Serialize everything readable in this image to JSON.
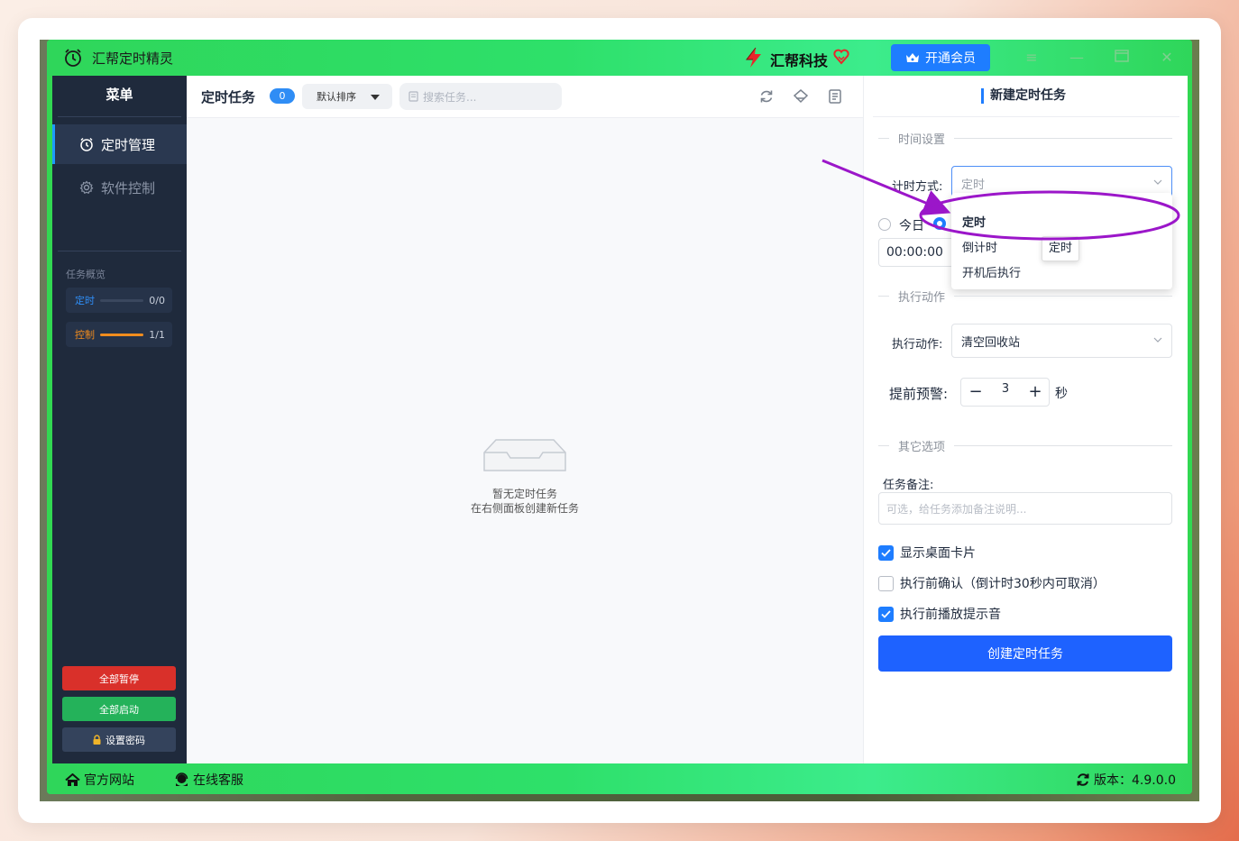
{
  "app": {
    "title": "汇帮定时精灵",
    "brand": "汇帮科技",
    "vip_button": "开通会员"
  },
  "sidebar": {
    "title": "菜单",
    "items": [
      {
        "label": "定时管理",
        "icon": "alarm-clock-icon",
        "active": true
      },
      {
        "label": "软件控制",
        "icon": "gear-icon",
        "active": false
      }
    ],
    "overview_label": "任务概览",
    "overview": [
      {
        "label": "定时",
        "count": "0/0",
        "progress": 0,
        "color": "#2f8df5"
      },
      {
        "label": "控制",
        "count": "1/1",
        "progress": 1,
        "color": "#f08c1e"
      }
    ],
    "buttons": {
      "pause_all": "全部暂停",
      "start_all": "全部启动",
      "set_password": "设置密码"
    }
  },
  "main": {
    "title": "定时任务",
    "count": "0",
    "sort_label": "默认排序",
    "search_placeholder": "搜索任务...",
    "empty_line1": "暂无定时任务",
    "empty_line2": "在右侧面板创建新任务"
  },
  "form": {
    "title": "新建定时任务",
    "section_time": "时间设置",
    "timing_mode_label": "计时方式:",
    "timing_mode_value": "定时",
    "dropdown_options": [
      "定时",
      "倒计时",
      "开机后执行"
    ],
    "tooltip": "定时",
    "radio_today": "今日",
    "time_value": "00:00:00",
    "section_action": "执行动作",
    "action_label": "执行动作:",
    "action_value": "清空回收站",
    "warn_label": "提前预警:",
    "warn_value": "3",
    "warn_unit": "秒",
    "section_other": "其它选项",
    "note_label": "任务备注:",
    "note_placeholder": "可选，给任务添加备注说明...",
    "checks": [
      {
        "label": "显示桌面卡片",
        "checked": true
      },
      {
        "label": "执行前确认（倒计时30秒内可取消）",
        "checked": false
      },
      {
        "label": "执行前播放提示音",
        "checked": true
      }
    ],
    "create_button": "创建定时任务"
  },
  "footer": {
    "website": "官方网站",
    "support": "在线客服",
    "version": "版本：4.9.0.0"
  },
  "colors": {
    "accent": "#1e7dff",
    "titlebar_green": "#32d852",
    "sidebar_bg": "#1f2a3c",
    "annotation_purple": "#9b16c9"
  }
}
